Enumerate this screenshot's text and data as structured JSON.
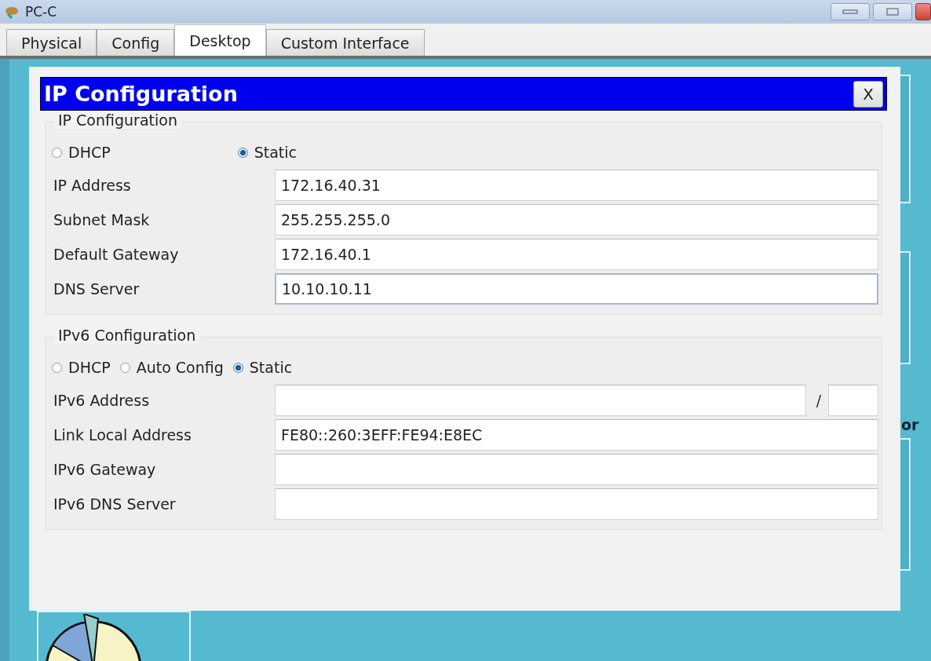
{
  "window": {
    "title": "PC-C"
  },
  "tabs": [
    {
      "label": "Physical",
      "selected": false
    },
    {
      "label": "Config",
      "selected": false
    },
    {
      "label": "Desktop",
      "selected": true
    },
    {
      "label": "Custom Interface",
      "selected": false
    }
  ],
  "dialog": {
    "title": "IP Configuration",
    "close": "X",
    "ip_group": {
      "legend": "IP Configuration",
      "modes": [
        {
          "label": "DHCP",
          "selected": false
        },
        {
          "label": "Static",
          "selected": true
        }
      ],
      "fields": [
        {
          "label": "IP Address",
          "value": "172.16.40.31",
          "focused": false
        },
        {
          "label": "Subnet Mask",
          "value": "255.255.255.0",
          "focused": false
        },
        {
          "label": "Default Gateway",
          "value": "172.16.40.1",
          "focused": false
        },
        {
          "label": "DNS Server",
          "value": "10.10.10.11",
          "focused": true
        }
      ]
    },
    "ipv6_group": {
      "legend": "IPv6 Configuration",
      "modes": [
        {
          "label": "DHCP",
          "selected": false
        },
        {
          "label": "Auto Config",
          "selected": false
        },
        {
          "label": "Static",
          "selected": true
        }
      ],
      "fields": [
        {
          "label": "IPv6 Address",
          "kind": "prefixed",
          "separator": "/",
          "focused": false
        },
        {
          "label": "Link Local Address",
          "kind": "text",
          "value": "FE80::260:3EFF:FE94:E8EC",
          "focused": false
        },
        {
          "label": "IPv6 Gateway",
          "kind": "text",
          "focused": false
        },
        {
          "label": "IPv6 DNS Server",
          "kind": "text",
          "focused": false
        }
      ]
    }
  },
  "desktop": {
    "partial_label": "or"
  }
}
